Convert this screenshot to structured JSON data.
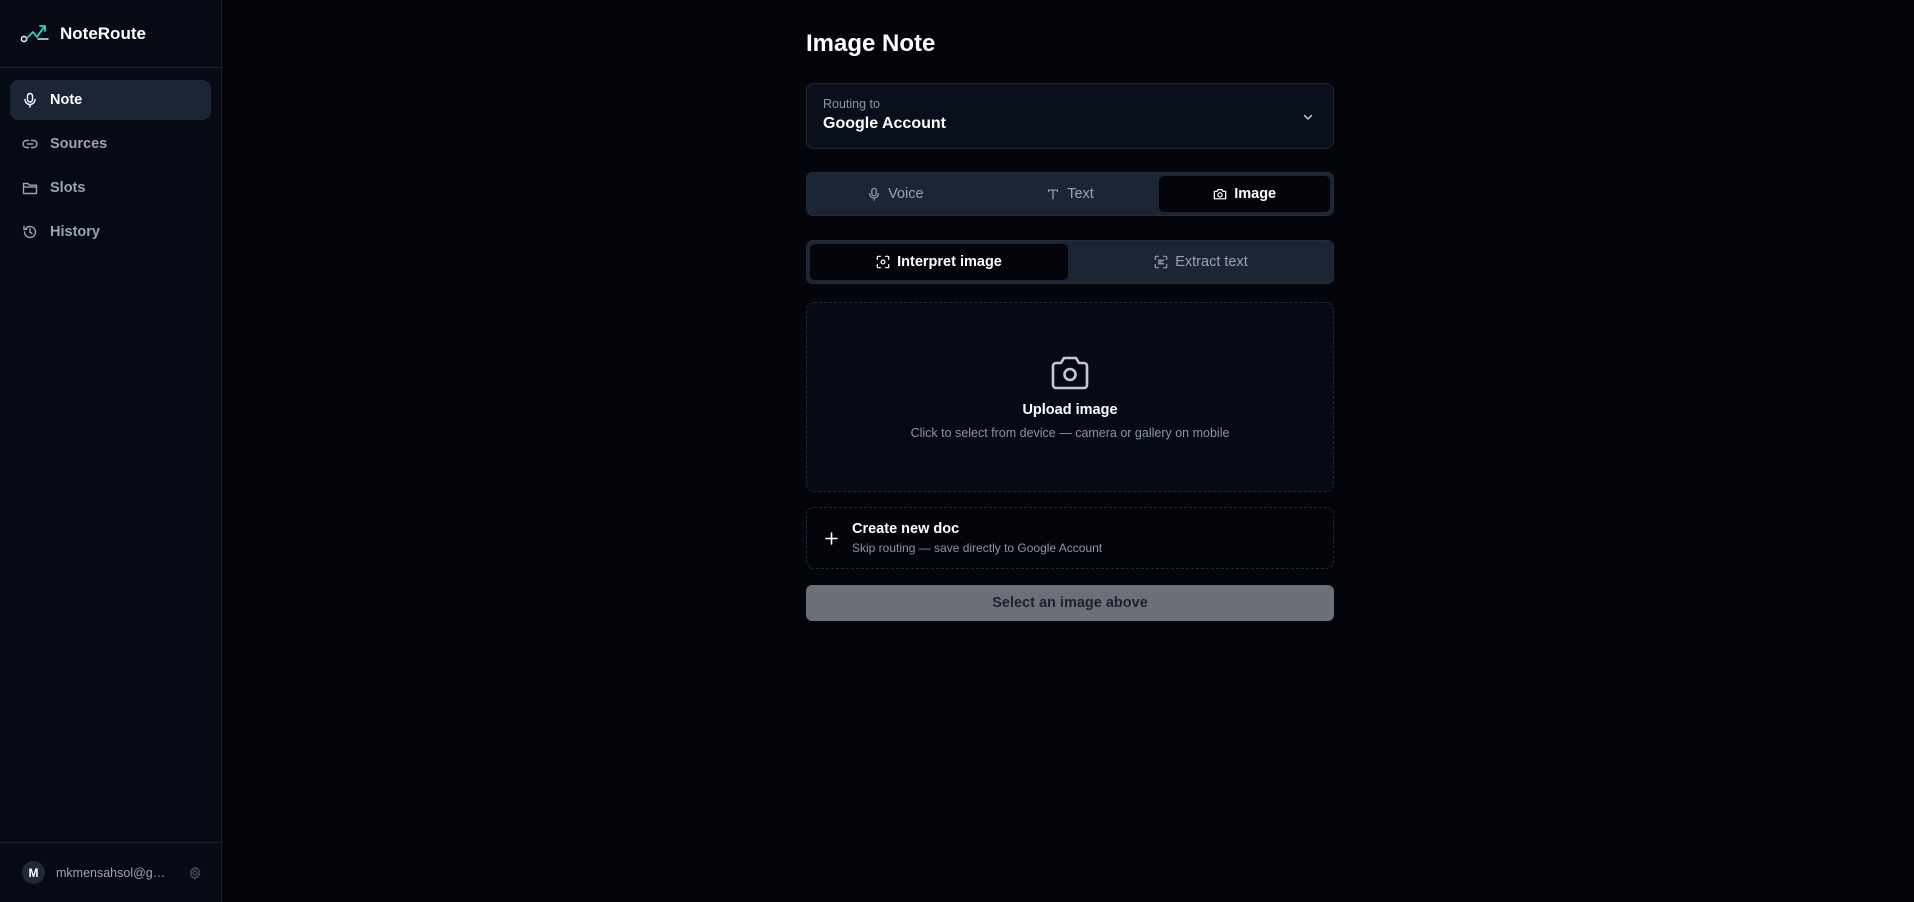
{
  "app": {
    "name": "NoteRoute"
  },
  "sidebar": {
    "items": [
      {
        "label": "Note",
        "icon": "mic-icon",
        "active": true
      },
      {
        "label": "Sources",
        "icon": "link-icon"
      },
      {
        "label": "Slots",
        "icon": "folder-icon"
      },
      {
        "label": "History",
        "icon": "history-icon"
      }
    ],
    "user": {
      "initial": "M",
      "email": "mkmensahsol@gm..."
    }
  },
  "page": {
    "title": "Image Note"
  },
  "routing": {
    "label": "Routing to",
    "value": "Google Account"
  },
  "mode_tabs": [
    {
      "label": "Voice",
      "icon": "mic-icon"
    },
    {
      "label": "Text",
      "icon": "text-icon"
    },
    {
      "label": "Image",
      "icon": "camera-icon",
      "active": true
    }
  ],
  "action_tabs": [
    {
      "label": "Interpret image",
      "icon": "scan-icon",
      "active": true
    },
    {
      "label": "Extract text",
      "icon": "scan-text-icon"
    }
  ],
  "upload": {
    "title": "Upload image",
    "subtitle": "Click to select from device — camera or gallery on mobile"
  },
  "create_doc": {
    "title": "Create new doc",
    "subtitle": "Skip routing — save directly to Google Account"
  },
  "submit": {
    "label": "Select an image above"
  },
  "colors": {
    "background": "#03050b",
    "panel": "#0a0f1c",
    "accent": "#2dd4bf",
    "disabled_button": "#6b6f78"
  }
}
